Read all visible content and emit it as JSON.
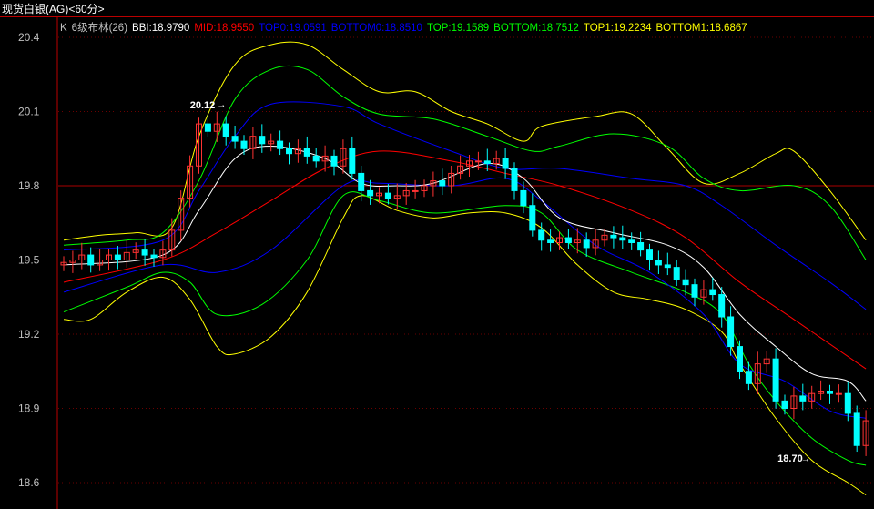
{
  "title": "现货白银(AG)<60分>",
  "legend": [
    {
      "text": "K",
      "color": "#c0c0c0"
    },
    {
      "text": "6级布林(26)",
      "color": "#c0c0c0"
    },
    {
      "text": "BBI:18.9790",
      "color": "#ffffff"
    },
    {
      "text": "MID:18.9550",
      "color": "#ff0000"
    },
    {
      "text": "TOP0:19.0591",
      "color": "#0000ff"
    },
    {
      "text": "BOTTOM0:18.8510",
      "color": "#0000ff"
    },
    {
      "text": "TOP:19.1589",
      "color": "#00ff00"
    },
    {
      "text": "BOTTOM:18.7512",
      "color": "#00ff00"
    },
    {
      "text": "TOP1:19.2234",
      "color": "#ffff00"
    },
    {
      "text": "BOTTOM1:18.6867",
      "color": "#ffff00"
    }
  ],
  "chart_data": {
    "type": "candlestick",
    "ylim": [
      18.6,
      20.4
    ],
    "yticks": [
      "20.4",
      "20.1",
      "19.8",
      "19.5",
      "19.2",
      "18.9",
      "18.6"
    ],
    "up_color": "#ff3232",
    "down_color": "#00ffff",
    "closes": [
      19.49,
      19.5,
      19.52,
      19.48,
      19.5,
      19.52,
      19.5,
      19.53,
      19.54,
      19.52,
      19.51,
      19.54,
      19.62,
      19.75,
      19.88,
      20.05,
      20.02,
      20.05,
      20.0,
      19.98,
      19.95,
      20.0,
      19.97,
      19.98,
      19.95,
      19.93,
      19.95,
      19.92,
      19.9,
      19.92,
      19.88,
      19.95,
      19.85,
      19.78,
      19.76,
      19.77,
      19.75,
      19.76,
      19.78,
      19.78,
      19.8,
      19.82,
      19.8,
      19.85,
      19.88,
      19.9,
      19.9,
      19.89,
      19.91,
      19.87,
      19.78,
      19.72,
      19.62,
      19.58,
      19.57,
      19.59,
      19.57,
      19.58,
      19.55,
      19.58,
      19.6,
      19.59,
      19.58,
      19.57,
      19.54,
      19.5,
      19.48,
      19.47,
      19.42,
      19.4,
      19.35,
      19.38,
      19.36,
      19.27,
      19.15,
      19.05,
      19.0,
      19.08,
      19.1,
      18.93,
      18.9,
      18.95,
      18.93,
      18.96,
      18.97,
      18.96,
      18.96,
      18.88,
      18.75,
      18.85
    ],
    "lines": [
      {
        "name": "TOP1",
        "color": "#ffff00",
        "points": [
          [
            0,
            19.58
          ],
          [
            4,
            19.6
          ],
          [
            8,
            19.61
          ],
          [
            12,
            19.63
          ],
          [
            15,
            20.0
          ],
          [
            19,
            20.29
          ],
          [
            23,
            20.37
          ],
          [
            27,
            20.37
          ],
          [
            31,
            20.27
          ],
          [
            35,
            20.18
          ],
          [
            39,
            20.18
          ],
          [
            43,
            20.1
          ],
          [
            47,
            20.05
          ],
          [
            51,
            19.98
          ],
          [
            53,
            20.04
          ],
          [
            59,
            20.08
          ],
          [
            63,
            20.09
          ],
          [
            67,
            19.95
          ],
          [
            71,
            19.81
          ],
          [
            75,
            19.85
          ],
          [
            79,
            19.93
          ],
          [
            81,
            19.94
          ],
          [
            85,
            19.78
          ],
          [
            89,
            19.58
          ]
        ]
      },
      {
        "name": "BOTTOM1",
        "color": "#ffff00",
        "points": [
          [
            0,
            19.26
          ],
          [
            3,
            19.26
          ],
          [
            7,
            19.37
          ],
          [
            11,
            19.43
          ],
          [
            14,
            19.34
          ],
          [
            17,
            19.15
          ],
          [
            19,
            19.12
          ],
          [
            23,
            19.19
          ],
          [
            27,
            19.37
          ],
          [
            31,
            19.67
          ],
          [
            33,
            19.76
          ],
          [
            37,
            19.7
          ],
          [
            41,
            19.67
          ],
          [
            45,
            19.69
          ],
          [
            49,
            19.69
          ],
          [
            53,
            19.63
          ],
          [
            57,
            19.48
          ],
          [
            61,
            19.37
          ],
          [
            65,
            19.34
          ],
          [
            69,
            19.3
          ],
          [
            73,
            19.21
          ],
          [
            75,
            19.08
          ],
          [
            79,
            18.86
          ],
          [
            83,
            18.69
          ],
          [
            87,
            18.6
          ],
          [
            89,
            18.55
          ]
        ]
      },
      {
        "name": "TOP",
        "color": "#00ff00",
        "points": [
          [
            0,
            19.56
          ],
          [
            7,
            19.58
          ],
          [
            11,
            19.61
          ],
          [
            15,
            19.82
          ],
          [
            19,
            20.15
          ],
          [
            23,
            20.27
          ],
          [
            27,
            20.27
          ],
          [
            31,
            20.16
          ],
          [
            35,
            20.09
          ],
          [
            41,
            20.07
          ],
          [
            47,
            20.0
          ],
          [
            52,
            19.94
          ],
          [
            55,
            19.96
          ],
          [
            61,
            20.01
          ],
          [
            67,
            19.96
          ],
          [
            71,
            19.83
          ],
          [
            75,
            19.78
          ],
          [
            81,
            19.8
          ],
          [
            85,
            19.72
          ],
          [
            89,
            19.5
          ]
        ]
      },
      {
        "name": "BOTTOM",
        "color": "#00ff00",
        "points": [
          [
            0,
            19.29
          ],
          [
            7,
            19.39
          ],
          [
            11,
            19.45
          ],
          [
            14,
            19.41
          ],
          [
            17,
            19.28
          ],
          [
            22,
            19.32
          ],
          [
            27,
            19.5
          ],
          [
            31,
            19.76
          ],
          [
            35,
            19.74
          ],
          [
            41,
            19.69
          ],
          [
            49,
            19.72
          ],
          [
            53,
            19.69
          ],
          [
            57,
            19.54
          ],
          [
            63,
            19.45
          ],
          [
            69,
            19.37
          ],
          [
            73,
            19.28
          ],
          [
            76,
            19.08
          ],
          [
            79,
            18.93
          ],
          [
            83,
            18.78
          ],
          [
            87,
            18.69
          ],
          [
            89,
            18.67
          ]
        ]
      },
      {
        "name": "TOP0",
        "color": "#0000ff",
        "points": [
          [
            0,
            19.54
          ],
          [
            11,
            19.58
          ],
          [
            15,
            19.78
          ],
          [
            19,
            20.0
          ],
          [
            23,
            20.13
          ],
          [
            31,
            20.12
          ],
          [
            35,
            20.05
          ],
          [
            43,
            19.94
          ],
          [
            49,
            19.87
          ],
          [
            55,
            19.87
          ],
          [
            63,
            19.83
          ],
          [
            69,
            19.8
          ],
          [
            73,
            19.72
          ],
          [
            79,
            19.56
          ],
          [
            85,
            19.41
          ],
          [
            89,
            19.3
          ]
        ]
      },
      {
        "name": "BOTTOM0",
        "color": "#0000ff",
        "points": [
          [
            0,
            19.37
          ],
          [
            11,
            19.48
          ],
          [
            17,
            19.45
          ],
          [
            23,
            19.54
          ],
          [
            31,
            19.8
          ],
          [
            35,
            19.81
          ],
          [
            43,
            19.8
          ],
          [
            49,
            19.83
          ],
          [
            53,
            19.74
          ],
          [
            59,
            19.56
          ],
          [
            65,
            19.45
          ],
          [
            71,
            19.28
          ],
          [
            75,
            19.08
          ],
          [
            80,
            19.01
          ],
          [
            85,
            18.89
          ],
          [
            89,
            18.86
          ]
        ]
      },
      {
        "name": "MID",
        "color": "#ff0000",
        "points": [
          [
            0,
            19.41
          ],
          [
            11,
            19.5
          ],
          [
            17,
            19.61
          ],
          [
            23,
            19.74
          ],
          [
            29,
            19.87
          ],
          [
            35,
            19.94
          ],
          [
            43,
            19.9
          ],
          [
            49,
            19.85
          ],
          [
            55,
            19.8
          ],
          [
            63,
            19.7
          ],
          [
            69,
            19.59
          ],
          [
            75,
            19.41
          ],
          [
            81,
            19.26
          ],
          [
            89,
            19.06
          ]
        ]
      },
      {
        "name": "BBI",
        "color": "#ffffff",
        "points": [
          [
            0,
            19.48
          ],
          [
            11,
            19.52
          ],
          [
            15,
            19.7
          ],
          [
            19,
            19.91
          ],
          [
            23,
            19.96
          ],
          [
            29,
            19.91
          ],
          [
            33,
            19.81
          ],
          [
            37,
            19.8
          ],
          [
            41,
            19.81
          ],
          [
            47,
            19.89
          ],
          [
            51,
            19.83
          ],
          [
            55,
            19.67
          ],
          [
            61,
            19.61
          ],
          [
            67,
            19.56
          ],
          [
            71,
            19.47
          ],
          [
            75,
            19.28
          ],
          [
            79,
            19.15
          ],
          [
            83,
            19.04
          ],
          [
            87,
            19.01
          ],
          [
            89,
            18.93
          ]
        ]
      }
    ],
    "annotations": [
      {
        "text": "20.12",
        "index": 17,
        "value": 20.12
      },
      {
        "text": "18.70",
        "index": 83,
        "value": 18.7
      }
    ]
  }
}
